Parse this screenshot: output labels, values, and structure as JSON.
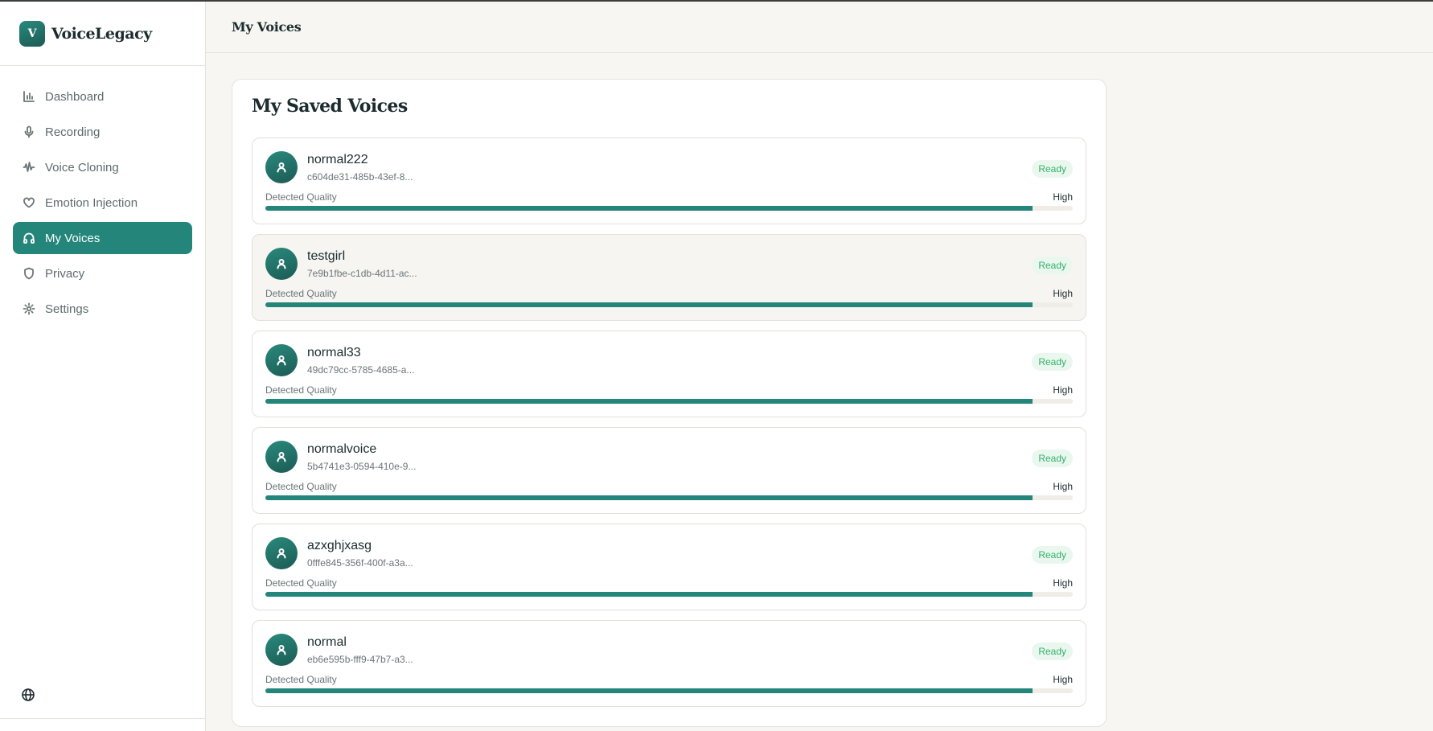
{
  "app": {
    "logo_letter": "V",
    "name": "VoiceLegacy",
    "accent_color": "#24867a"
  },
  "sidebar": {
    "items": [
      {
        "label": "Dashboard",
        "icon": "bar-chart-icon"
      },
      {
        "label": "Recording",
        "icon": "microphone-icon"
      },
      {
        "label": "Voice Cloning",
        "icon": "waveform-icon"
      },
      {
        "label": "Emotion Injection",
        "icon": "heart-icon"
      },
      {
        "label": "My Voices",
        "icon": "headphones-icon",
        "active": true
      },
      {
        "label": "Privacy",
        "icon": "shield-icon"
      },
      {
        "label": "Settings",
        "icon": "gear-icon"
      }
    ],
    "footer_icon": "globe-icon"
  },
  "header": {
    "title": "My Voices"
  },
  "panel": {
    "title": "My Saved Voices",
    "voices": [
      {
        "name": "normal222",
        "id": "c604de31-485b-43ef-8...",
        "status": "Ready",
        "quality_label": "Detected Quality",
        "quality": "High",
        "quality_fraction": 0.95
      },
      {
        "name": "testgirl",
        "id": "7e9b1fbe-c1db-4d11-ac...",
        "status": "Ready",
        "quality_label": "Detected Quality",
        "quality": "High",
        "quality_fraction": 0.95
      },
      {
        "name": "normal33",
        "id": "49dc79cc-5785-4685-a...",
        "status": "Ready",
        "quality_label": "Detected Quality",
        "quality": "High",
        "quality_fraction": 0.95
      },
      {
        "name": "normalvoice",
        "id": "5b4741e3-0594-410e-9...",
        "status": "Ready",
        "quality_label": "Detected Quality",
        "quality": "High",
        "quality_fraction": 0.95
      },
      {
        "name": "azxghjxasg",
        "id": "0fffe845-356f-400f-a3a...",
        "status": "Ready",
        "quality_label": "Detected Quality",
        "quality": "High",
        "quality_fraction": 0.95
      },
      {
        "name": "normal",
        "id": "eb6e595b-fff9-47b7-a3...",
        "status": "Ready",
        "quality_label": "Detected Quality",
        "quality": "High",
        "quality_fraction": 0.95
      }
    ]
  }
}
